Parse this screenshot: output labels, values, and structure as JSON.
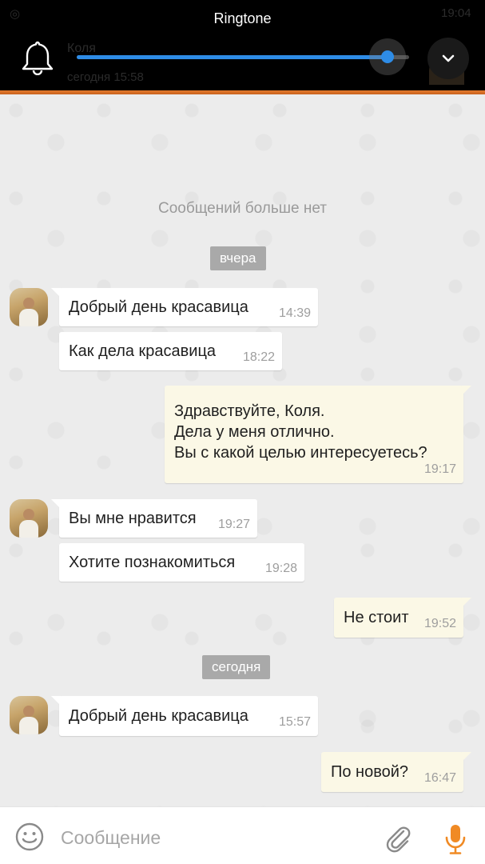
{
  "status_bar": {
    "time": "19:04"
  },
  "volume_panel": {
    "title": "Ringtone",
    "level_fraction": 0.935,
    "accent_color": "#2e8ce6",
    "icons": [
      "bell-icon",
      "chevron-down-icon"
    ]
  },
  "conversation_header": {
    "contact_name": "Коля",
    "last_seen": "сегодня 15:58"
  },
  "chat": {
    "no_more_messages": "Сообщений больше нет",
    "dates": {
      "yesterday": "вчера",
      "today": "сегодня"
    },
    "messages": [
      {
        "direction": "in",
        "text": "Добрый день красавица",
        "time": "14:39"
      },
      {
        "direction": "in",
        "text": "Как дела красавица",
        "time": "18:22"
      },
      {
        "direction": "out",
        "lines": [
          "Здравствуйте, Коля.",
          "Дела у меня отлично.",
          "Вы с какой целью интересуетесь?"
        ],
        "time": "19:17"
      },
      {
        "direction": "in",
        "text": "Вы мне нравится",
        "time": "19:27"
      },
      {
        "direction": "in",
        "text": "Хотите познакомиться",
        "time": "19:28"
      },
      {
        "direction": "out",
        "text": "Не стоит",
        "time": "19:52"
      },
      {
        "direction": "in",
        "text": "Добрый день красавица",
        "time": "15:57"
      },
      {
        "direction": "out",
        "text": "По новой?",
        "time": "16:47"
      }
    ]
  },
  "composer": {
    "placeholder": "Сообщение",
    "value": "",
    "icons": [
      "emoji-icon",
      "attach-icon",
      "microphone-icon"
    ],
    "mic_color": "#f08a24"
  }
}
